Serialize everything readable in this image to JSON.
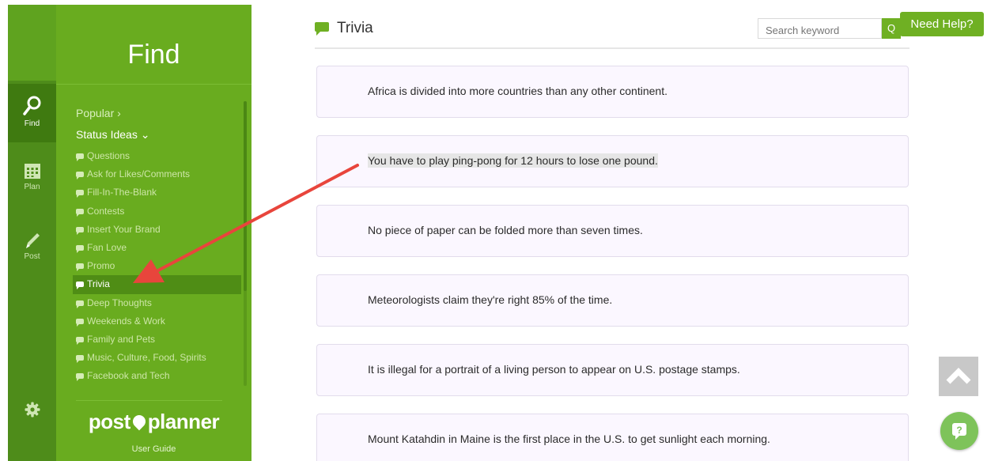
{
  "sidebar_rail": {
    "items": [
      {
        "label": "Find",
        "icon": "search-icon"
      },
      {
        "label": "Plan",
        "icon": "calendar-icon"
      },
      {
        "label": "Post",
        "icon": "pencil-icon"
      },
      {
        "label": "",
        "icon": "gear-icon"
      }
    ]
  },
  "panel": {
    "title": "Find",
    "popular": "Popular ›",
    "status_ideas": "Status Ideas ⌄",
    "items": [
      "Questions",
      "Ask for Likes/Comments",
      "Fill-In-The-Blank",
      "Contests",
      "Insert Your Brand",
      "Fan Love",
      "Promo",
      "Trivia",
      "Deep Thoughts",
      "Weekends & Work",
      "Family and Pets",
      "Music, Culture, Food, Spirits",
      "Facebook and Tech"
    ],
    "active_item": "Trivia",
    "brand_left": "post",
    "brand_right": "planner",
    "user_guide": "User Guide"
  },
  "header": {
    "title": "Trivia",
    "search_placeholder": "Search keyword",
    "search_button": "Q",
    "help_button": "Need Help?"
  },
  "cards": [
    "Africa is divided into more countries than any other continent.",
    "You have to play ping-pong for 12 hours to lose one pound.",
    "No piece of paper can be folded more than seven times.",
    "Meteorologists claim they're right 85% of the time.",
    "It is illegal for a portrait of a living person to appear on U.S. postage stamps.",
    "Mount Katahdin in Maine is the first place in the U.S. to get sunlight each morning."
  ],
  "highlighted_card": 1,
  "colors": {
    "rail": "#4e8c1a",
    "panel": "#69ac1f",
    "accent": "#6fb023",
    "arrow": "#e8453c",
    "card_bg": "#fbf7ff"
  }
}
